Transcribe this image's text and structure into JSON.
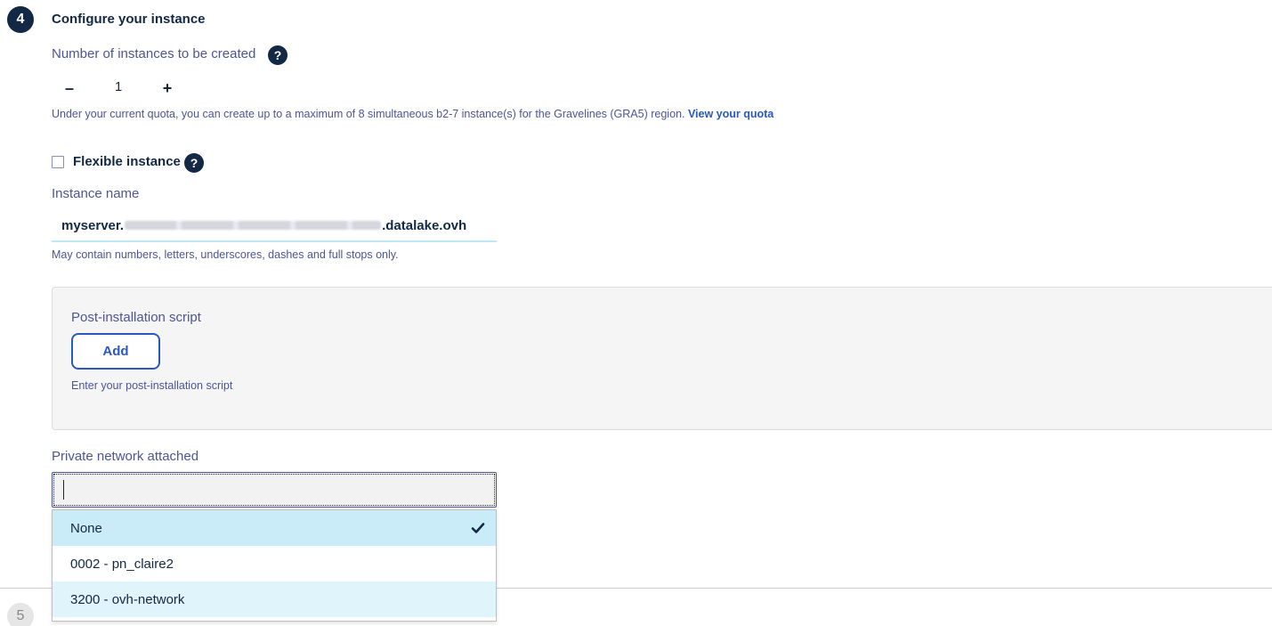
{
  "step4": {
    "number": "4",
    "title": "Configure your instance"
  },
  "instances": {
    "label": "Number of instances to be created",
    "help": "?",
    "decrement": "–",
    "value": "1",
    "increment": "+",
    "quota_text": "Under your current quota, you can create up to a maximum of 8 simultaneous b2-7 instance(s) for the Gravelines (GRA5) region.",
    "quota_link": "View your quota"
  },
  "flexible": {
    "label": "Flexible instance",
    "help": "?"
  },
  "instance_name": {
    "label": "Instance name",
    "prefix": "myserver.",
    "suffix": ".datalake.ovh",
    "hint": "May contain numbers, letters, underscores, dashes and full stops only."
  },
  "post_install": {
    "label": "Post-installation script",
    "add_button": "Add",
    "hint": "Enter your post-installation script"
  },
  "private_network": {
    "label": "Private network attached",
    "options": [
      {
        "label": "None",
        "selected": true
      },
      {
        "label": "0002 - pn_claire2",
        "selected": false
      },
      {
        "label": "3200 - ovh-network",
        "selected": false
      }
    ]
  },
  "step5": {
    "number": "5"
  },
  "colors": {
    "navy": "#122844",
    "link": "#2859c0",
    "selected_option": "#c9ecf8"
  },
  "icons": {
    "help": "question-circle-icon",
    "check": "check-icon"
  }
}
